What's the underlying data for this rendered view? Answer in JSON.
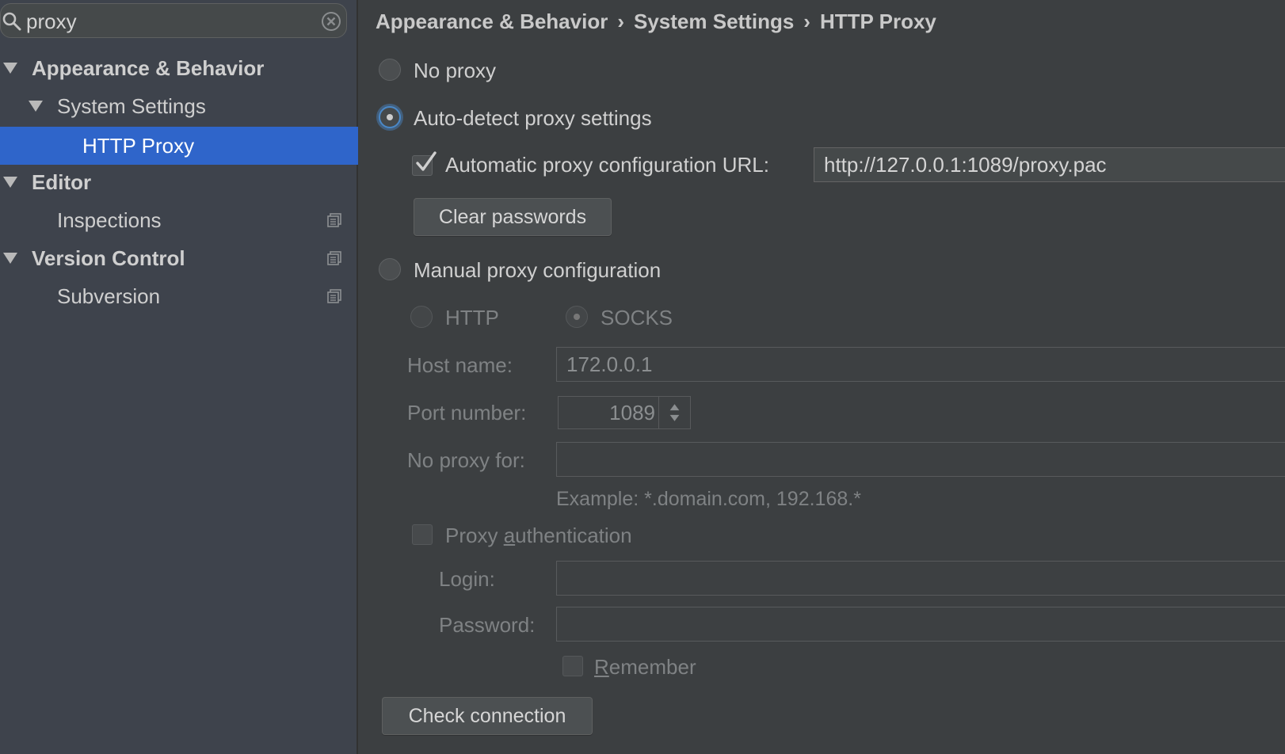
{
  "search": {
    "query": "proxy"
  },
  "sidebar": {
    "items": [
      {
        "label": "Appearance & Behavior",
        "level": 0,
        "expanded": true,
        "bold": true
      },
      {
        "label": "System Settings",
        "level": 1,
        "expanded": true,
        "bold": false
      },
      {
        "label": "HTTP Proxy",
        "level": 2,
        "selected": true
      },
      {
        "label": "Editor",
        "level": 0,
        "expanded": true,
        "bold": true
      },
      {
        "label": "Inspections",
        "level": 1,
        "project_icon": true
      },
      {
        "label": "Version Control",
        "level": 0,
        "expanded": true,
        "bold": true,
        "project_icon": true
      },
      {
        "label": "Subversion",
        "level": 1,
        "project_icon": true
      }
    ]
  },
  "breadcrumb": {
    "items": [
      "Appearance & Behavior",
      "System Settings",
      "HTTP Proxy"
    ],
    "separator": "›"
  },
  "proxy": {
    "no_proxy_label": "No proxy",
    "auto_detect_label": "Auto-detect proxy settings",
    "auto_detect_selected": true,
    "auto_config_url_label": "Automatic proxy configuration URL:",
    "auto_config_url_checked": true,
    "auto_config_url_value": "http://127.0.0.1:1089/proxy.pac",
    "clear_passwords_label": "Clear passwords",
    "manual_label": "Manual proxy configuration",
    "http_label": "HTTP",
    "socks_label": "SOCKS",
    "socks_selected": true,
    "host_name_label": "Host name:",
    "host_name_value": "172.0.0.1",
    "port_number_label": "Port number:",
    "port_number_value": "1089",
    "no_proxy_for_label": "No proxy for:",
    "no_proxy_for_value": "",
    "example_text": "Example: *.domain.com, 192.168.*",
    "auth_label_prefix": "Proxy ",
    "auth_label_mnemonic": "a",
    "auth_label_suffix": "uthentication",
    "auth_checked": false,
    "login_label": "Login:",
    "login_value": "",
    "password_label": "Password:",
    "password_value": "",
    "remember_mnemonic": "R",
    "remember_suffix": "emember",
    "remember_checked": false,
    "check_connection_label": "Check connection"
  },
  "colors": {
    "selection": "#2f65ca",
    "focus_ring": "#4a88c7",
    "panel_bg": "#3c3f41",
    "sidebar_bg": "#3e434c"
  }
}
